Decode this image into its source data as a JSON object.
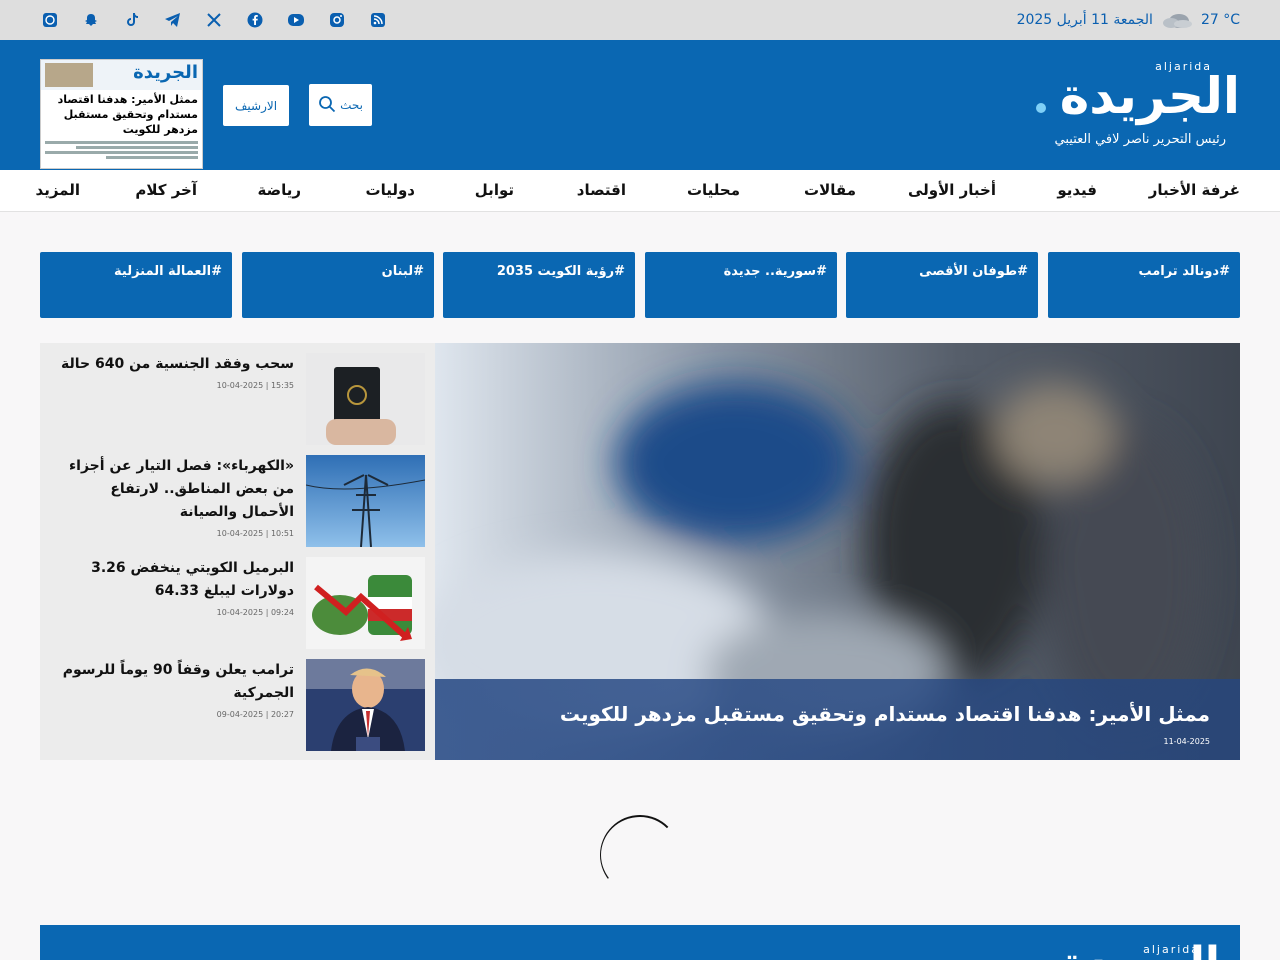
{
  "topbar": {
    "temperature": "27 °C",
    "date": "الجمعة 11 أبريل 2025",
    "social_icons": [
      "whatsapp-icon",
      "snapchat-icon",
      "tiktok-icon",
      "telegram-icon",
      "x-icon",
      "facebook-icon",
      "youtube-icon",
      "instagram-icon",
      "rss-icon"
    ]
  },
  "header": {
    "logo_arabic": "الجريدة",
    "logo_latin": "aljarida",
    "editor_line": "رئيس التحرير ناصر لافي العتيبي",
    "search_label": "بحث",
    "archive_label": "الارشيف",
    "paper_logo": "الجريدة",
    "paper_headline": "ممثل الأمير: هدفنا اقتصاد مستدام وتحقيق مستقبل مزدهر للكويت"
  },
  "nav": {
    "items": [
      "غرفة الأخبار",
      "فيديو",
      "أخبار الأولى",
      "مقالات",
      "محليات",
      "اقتصاد",
      "توابل",
      "دوليات",
      "رياضة",
      "آخر كلام",
      "المزيد"
    ]
  },
  "tags": [
    "#دونالد ترامب",
    "#طوفان الأقصى",
    "#سورية.. جديدة",
    "#رؤية الكويت 2035",
    "#لبنان",
    "#العمالة المنزلية"
  ],
  "hero": {
    "title": "ممثل الأمير: هدفنا اقتصاد مستدام وتحقيق مستقبل مزدهر للكويت",
    "date": "11-04-2025"
  },
  "side_news": [
    {
      "title": "سحب وفقد الجنسية من 640 حالة",
      "time": "10-04-2025 | 15:35"
    },
    {
      "title": "«الكهرباء»: فصل التيار عن أجزاء من بعض المناطق.. لارتفاع الأحمال والصيانة",
      "time": "10-04-2025 | 10:51"
    },
    {
      "title": "البرميل الكويتي ينخفض 3.26 دولارات ليبلغ 64.33",
      "time": "10-04-2025 | 09:24"
    },
    {
      "title": "ترامب يعلن وقفاً 90 يوماً للرسوم الجمركية",
      "time": "09-04-2025 | 20:27"
    }
  ],
  "footer": {
    "logo_arabic": "الجريدة",
    "logo_latin": "aljarida"
  },
  "colors": {
    "brand_blue": "#0a67b2",
    "topbar_bg": "#dedede"
  }
}
